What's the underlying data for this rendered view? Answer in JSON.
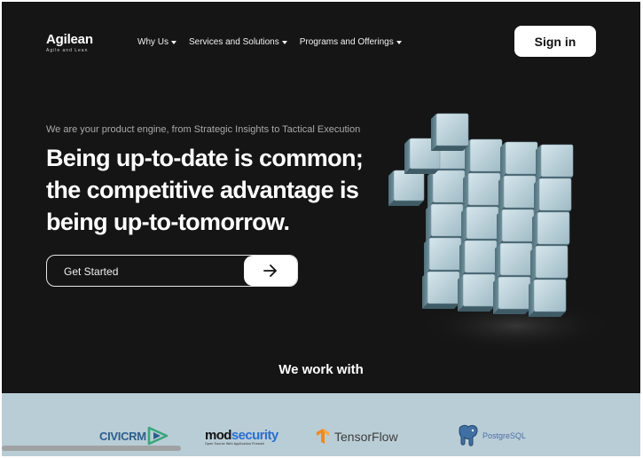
{
  "brand": {
    "name": "Agilean",
    "tagline": "Agile and Lean"
  },
  "nav": {
    "items": [
      {
        "label": "Why Us"
      },
      {
        "label": "Services and Solutions"
      },
      {
        "label": "Programs and Offerings"
      }
    ],
    "signin_label": "Sign in"
  },
  "hero": {
    "tagline": "We are your product engine, from Strategic Insights to Tactical Execution",
    "headline": "Being up-to-date is common; the competitive advantage is being up-to-tomorrow.",
    "cta_label": "Get Started"
  },
  "partners": {
    "heading": "We work with",
    "civicrm": "CIVICRM",
    "modsecurity_a": "mod",
    "modsecurity_b": "security",
    "modsecurity_sub": "Open Source Web Application Firewall",
    "tensorflow": "TensorFlow",
    "postgres": "PostgreSQL"
  },
  "colors": {
    "background": "#151515",
    "partner_band": "#b9cdd6",
    "cube": "#9cb8c3"
  }
}
